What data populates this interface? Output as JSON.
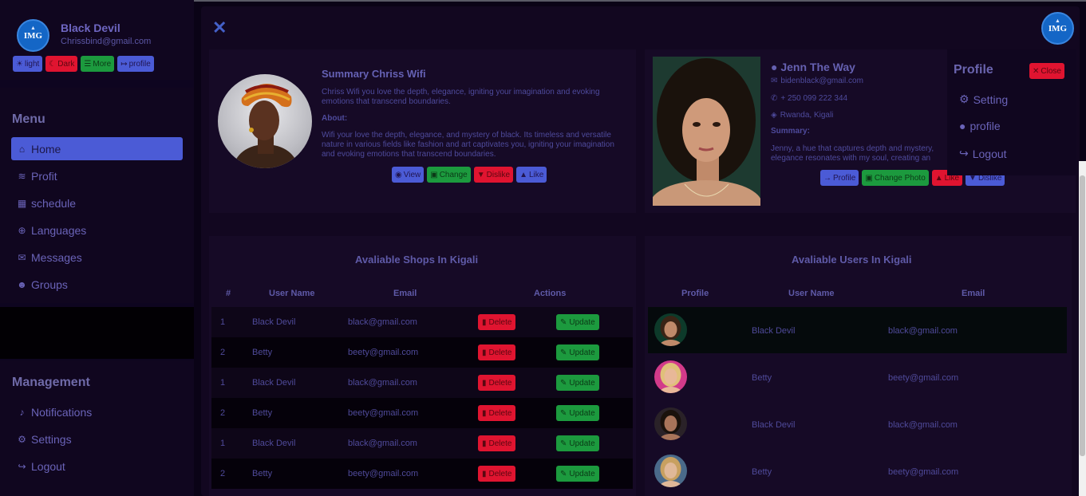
{
  "user": {
    "name": "Black Devil",
    "email": "Chrissbind@gmail.com",
    "logo_text": "IMG"
  },
  "theme_buttons": {
    "light": "light",
    "dark": "Dark",
    "more": "More",
    "profile": "profile"
  },
  "menu": {
    "title": "Menu",
    "items": [
      {
        "label": "Home",
        "icon": "home-icon"
      },
      {
        "label": "Profit",
        "icon": "coins-icon"
      },
      {
        "label": "schedule",
        "icon": "calendar-icon"
      },
      {
        "label": "Languages",
        "icon": "globe-icon"
      },
      {
        "label": "Messages",
        "icon": "chat-icon"
      },
      {
        "label": "Groups",
        "icon": "users-icon"
      }
    ]
  },
  "management": {
    "title": "Management",
    "items": [
      {
        "label": "Notifications",
        "icon": "bell-icon"
      },
      {
        "label": "Settings",
        "icon": "gear-icon"
      },
      {
        "label": "Logout",
        "icon": "logout-icon"
      }
    ]
  },
  "summary_card": {
    "title": "Summary Chriss Wifi",
    "intro": "Chriss Wifi you love the depth, elegance, igniting your imagination and evoking emotions that transcend boundaries.",
    "about_label": "About:",
    "about": "Wifi your love the depth, elegance, and mystery of black. Its timeless and versatile nature in various fields like fashion and art captivates you, igniting your imagination and evoking emotions that transcend boundaries.",
    "buttons": {
      "view": "View",
      "change": "Change",
      "dislike": "Dislike",
      "like": "Like"
    }
  },
  "person_card": {
    "name": "Jenn The Way",
    "email": "bidenblack@gmail.com",
    "phone": "+ 250 099 222 344",
    "location": "Rwanda, Kigali",
    "summary_label": "Summary:",
    "summary": "Jenny, a hue that captures depth and mystery, elegance resonates with my soul, creating an",
    "buttons": {
      "profile": "Profile",
      "change_photo": "Change Photo",
      "like": "Like",
      "dislike": "Dislike"
    }
  },
  "profile_dropdown": {
    "title": "Profile",
    "close": "Close",
    "items": [
      {
        "label": "Setting",
        "icon": "gear-icon"
      },
      {
        "label": "profile",
        "icon": "user-circle-icon"
      },
      {
        "label": "Logout",
        "icon": "logout-icon"
      }
    ]
  },
  "shops_table": {
    "title": "Avaliable Shops In Kigali",
    "headers": [
      "#",
      "User Name",
      "Email",
      "Actions"
    ],
    "delete_label": "Delete",
    "update_label": "Update",
    "rows": [
      {
        "num": "1",
        "name": "Black Devil",
        "email": "black@gmail.com"
      },
      {
        "num": "2",
        "name": "Betty",
        "email": "beety@gmail.com"
      },
      {
        "num": "1",
        "name": "Black Devil",
        "email": "black@gmail.com"
      },
      {
        "num": "2",
        "name": "Betty",
        "email": "beety@gmail.com"
      },
      {
        "num": "1",
        "name": "Black Devil",
        "email": "black@gmail.com"
      },
      {
        "num": "2",
        "name": "Betty",
        "email": "beety@gmail.com"
      }
    ]
  },
  "users_table": {
    "title": "Avaliable Users In Kigali",
    "headers": [
      "Profile",
      "User Name",
      "Email"
    ],
    "rows": [
      {
        "name": "Black Devil",
        "email": "black@gmail.com"
      },
      {
        "name": "Betty",
        "email": "beety@gmail.com"
      },
      {
        "name": "Black Devil",
        "email": "black@gmail.com"
      },
      {
        "name": "Betty",
        "email": "beety@gmail.com"
      }
    ]
  },
  "colors": {
    "accent_blue": "#4b5bd6",
    "danger_red": "#e01430",
    "success_green": "#1c9a3e",
    "background": "#0a0316"
  }
}
